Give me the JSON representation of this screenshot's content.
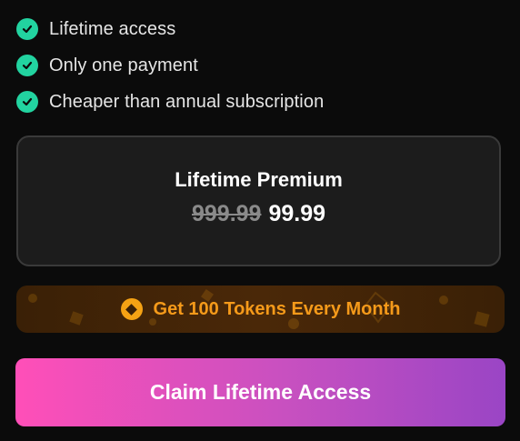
{
  "features": [
    {
      "label": "Lifetime access",
      "icon": "check-circle-icon"
    },
    {
      "label": "Only one payment",
      "icon": "check-circle-icon"
    },
    {
      "label": "Cheaper than annual subscription",
      "icon": "check-circle-icon"
    }
  ],
  "plan": {
    "title": "Lifetime Premium",
    "old_price": "999.99",
    "price": "99.99"
  },
  "token_banner": {
    "icon": "token-coin-icon",
    "text": "Get 100 Tokens Every Month"
  },
  "cta": {
    "label": "Claim Lifetime Access"
  },
  "colors": {
    "background": "#0b0b0b",
    "check": "#22d3a0",
    "token_text": "#f59a1a",
    "cta_gradient_start": "#ff4fb8",
    "cta_gradient_end": "#9a45c5"
  }
}
